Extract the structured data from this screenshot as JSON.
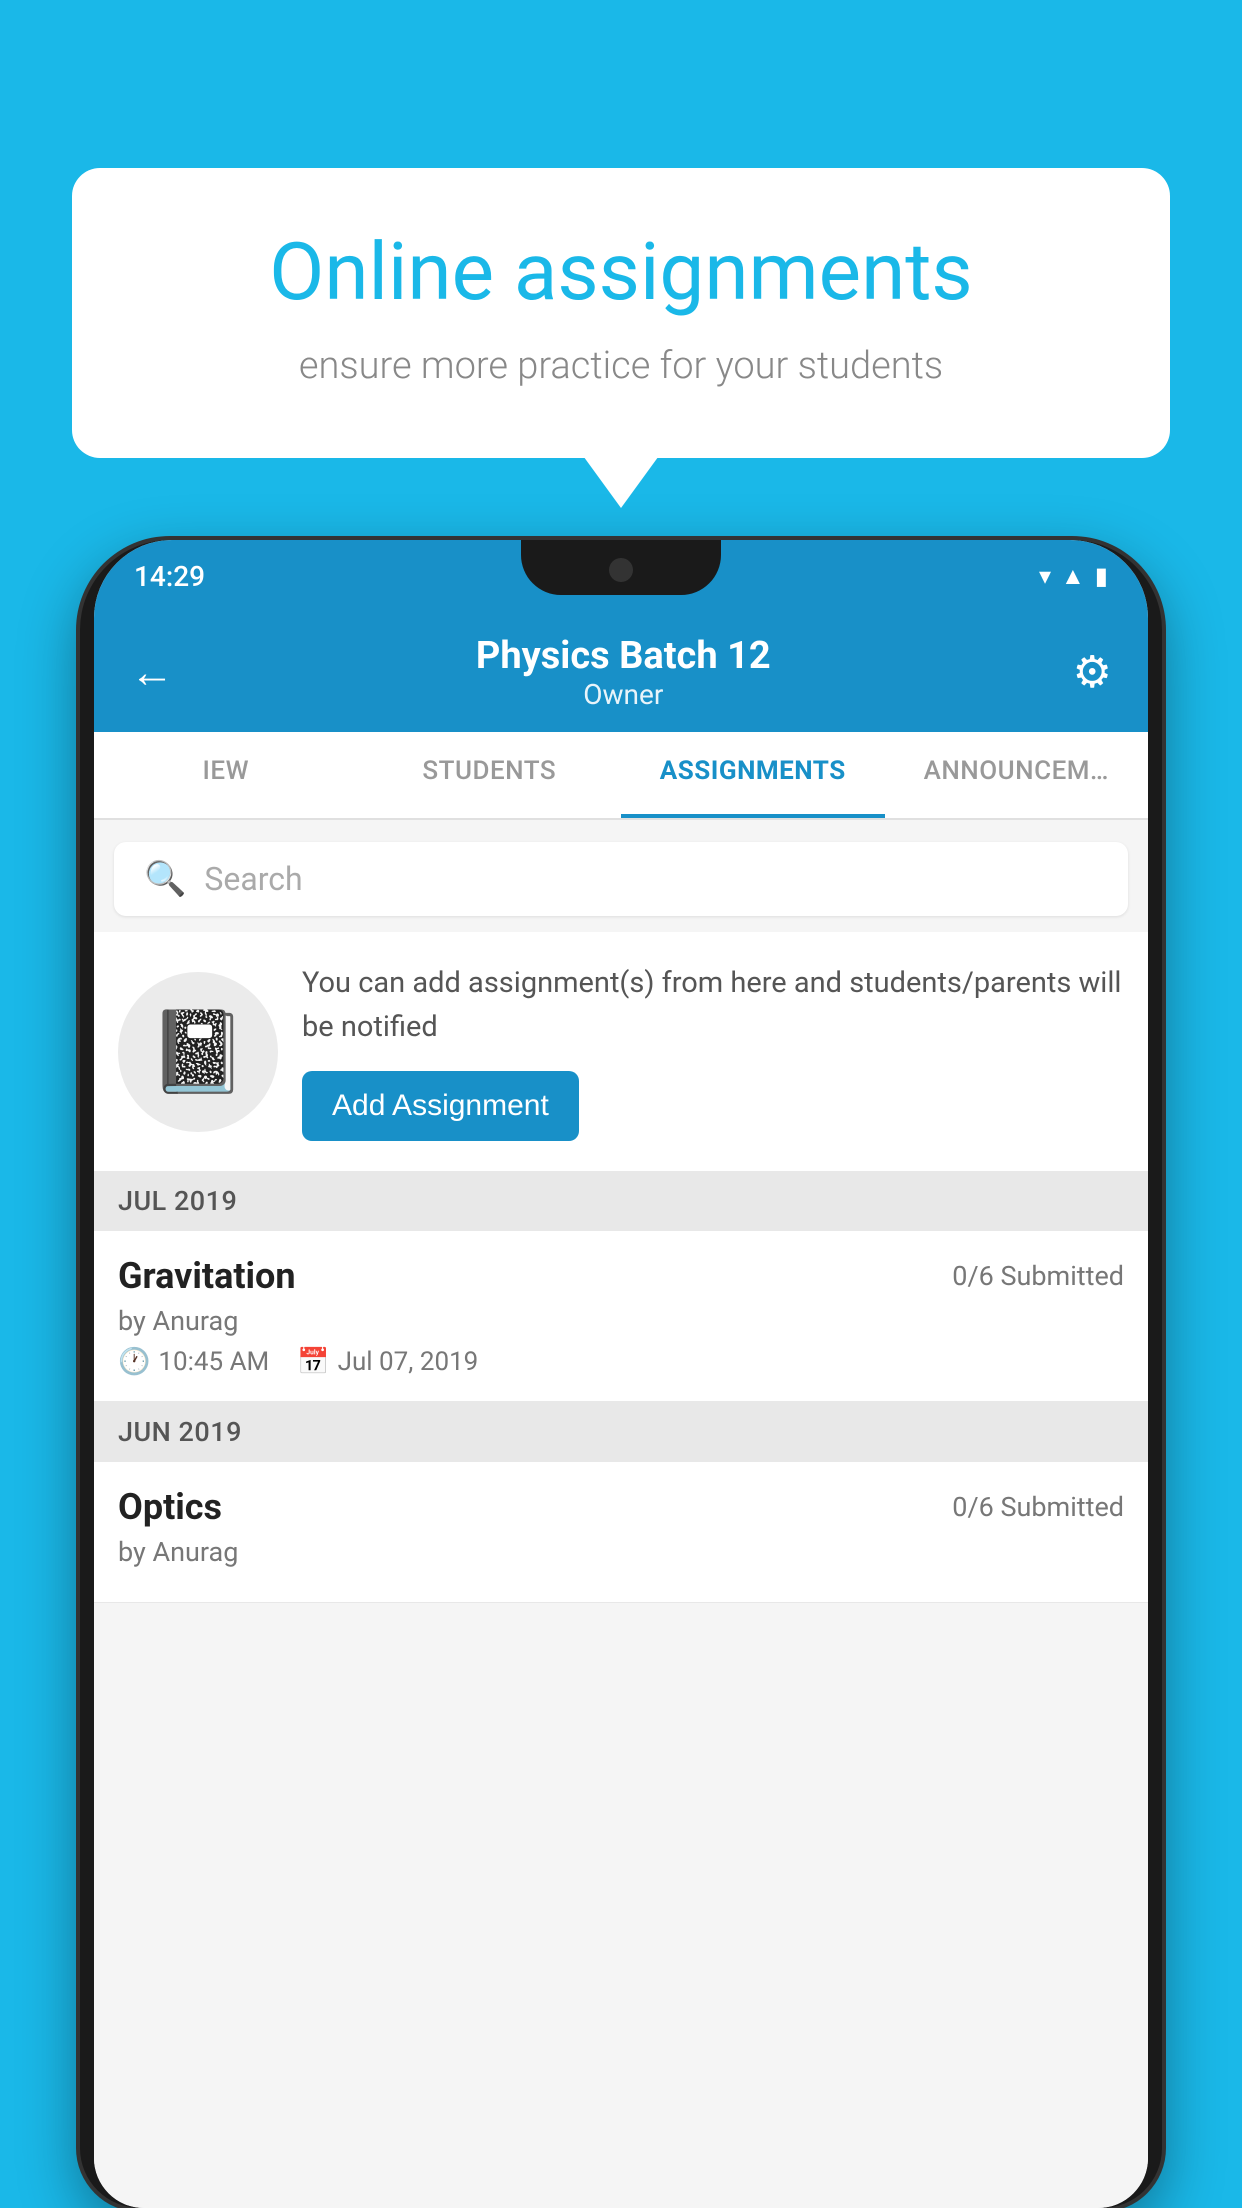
{
  "background": {
    "color": "#1ab8e8"
  },
  "speech_bubble": {
    "title": "Online assignments",
    "subtitle": "ensure more practice for your students"
  },
  "status_bar": {
    "time": "14:29",
    "wifi": "▾",
    "signal": "▲",
    "battery": "▮"
  },
  "app_bar": {
    "title": "Physics Batch 12",
    "subtitle": "Owner",
    "back_label": "←"
  },
  "tabs": [
    {
      "label": "IEW",
      "active": false
    },
    {
      "label": "STUDENTS",
      "active": false
    },
    {
      "label": "ASSIGNMENTS",
      "active": true
    },
    {
      "label": "ANNOUNCEM…",
      "active": false
    }
  ],
  "search": {
    "placeholder": "Search"
  },
  "promo": {
    "description": "You can add assignment(s) from here and students/parents will be notified",
    "button_label": "Add Assignment"
  },
  "sections": [
    {
      "header": "JUL 2019",
      "assignments": [
        {
          "name": "Gravitation",
          "submitted": "0/6 Submitted",
          "by": "by Anurag",
          "time": "10:45 AM",
          "date": "Jul 07, 2019"
        }
      ]
    },
    {
      "header": "JUN 2019",
      "assignments": [
        {
          "name": "Optics",
          "submitted": "0/6 Submitted",
          "by": "by Anurag",
          "time": "",
          "date": ""
        }
      ]
    }
  ]
}
